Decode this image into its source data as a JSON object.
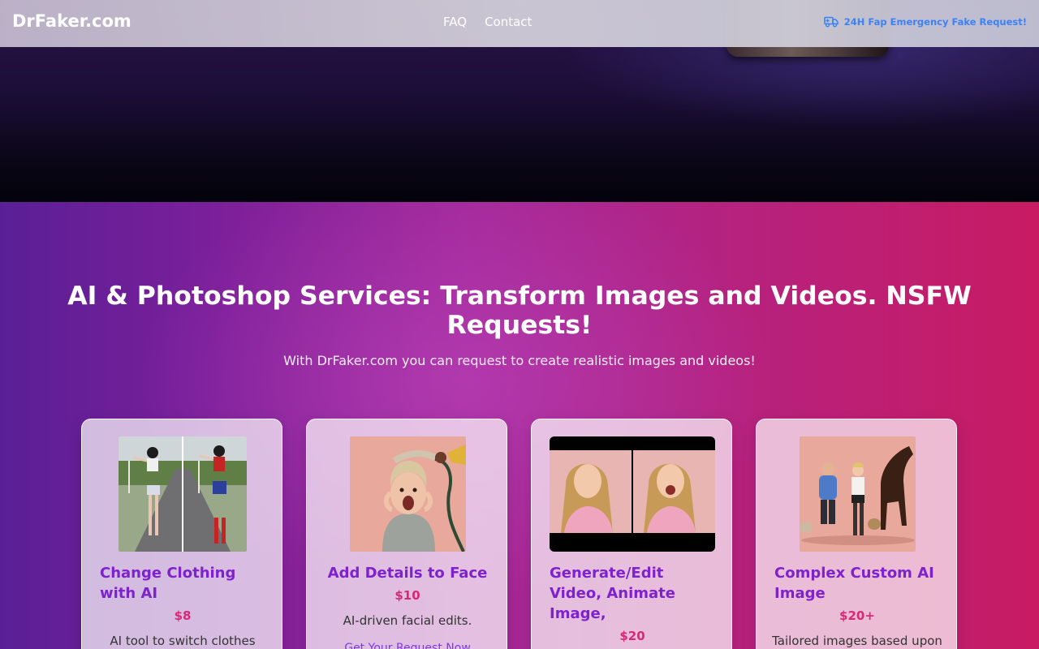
{
  "navbar": {
    "brand": "DrFaker.com",
    "links": [
      "FAQ",
      "Contact"
    ],
    "emergency_label": "24H Fap Emergency Fake Request!",
    "emergency_icon": "truck-icon"
  },
  "hero": {
    "title": "AI & Photoshop Services: Transform Images and Videos. NSFW Requests!",
    "subtitle": "With DrFaker.com you can request to create realistic images and videos!"
  },
  "cards": [
    {
      "title": "Change Clothing with AI",
      "price": "$8",
      "description": "AI tool to switch clothes"
    },
    {
      "title": "Add Details to Face",
      "price": "$10",
      "description": "AI-driven facial edits.",
      "link": "Get Your Request Now"
    },
    {
      "title": "Generate/Edit Video, Animate Image,",
      "price": "$20"
    },
    {
      "title": "Complex Custom AI Image",
      "price": "$20+",
      "description": "Tailored images based upon"
    }
  ],
  "colors": {
    "brand": "#ffffff",
    "accent_blue": "#3b82f6",
    "card_title": "#7e22ce",
    "price": "#db2777"
  }
}
